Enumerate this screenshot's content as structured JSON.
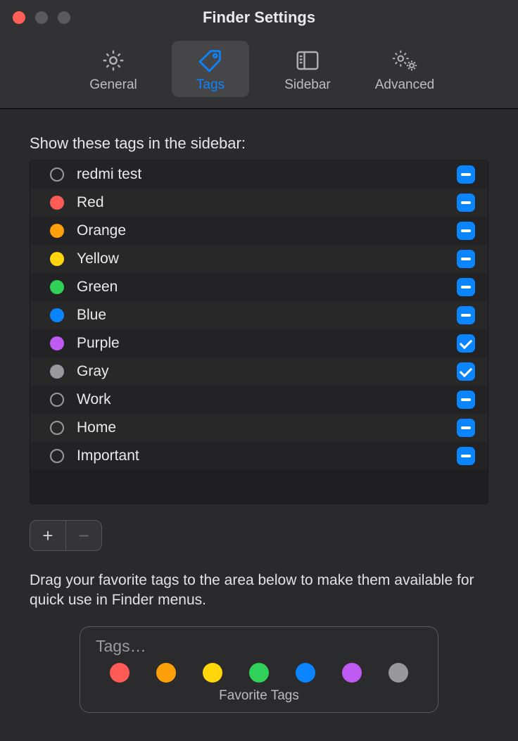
{
  "window": {
    "title": "Finder Settings"
  },
  "toolbar": {
    "items": [
      {
        "id": "general",
        "label": "General"
      },
      {
        "id": "tags",
        "label": "Tags"
      },
      {
        "id": "sidebar",
        "label": "Sidebar"
      },
      {
        "id": "advanced",
        "label": "Advanced"
      }
    ],
    "selected": "tags"
  },
  "section_label": "Show these tags in the sidebar:",
  "tags": [
    {
      "name": "redmi test",
      "color": null,
      "state": "mixed"
    },
    {
      "name": "Red",
      "color": "#ff5b56",
      "state": "mixed"
    },
    {
      "name": "Orange",
      "color": "#ff9f0a",
      "state": "mixed"
    },
    {
      "name": "Yellow",
      "color": "#ffd60a",
      "state": "mixed"
    },
    {
      "name": "Green",
      "color": "#30d158",
      "state": "mixed"
    },
    {
      "name": "Blue",
      "color": "#0a84ff",
      "state": "mixed"
    },
    {
      "name": "Purple",
      "color": "#bf5af2",
      "state": "checked"
    },
    {
      "name": "Gray",
      "color": "#98989d",
      "state": "checked"
    },
    {
      "name": "Work",
      "color": null,
      "state": "mixed"
    },
    {
      "name": "Home",
      "color": null,
      "state": "mixed"
    },
    {
      "name": "Important",
      "color": null,
      "state": "mixed"
    }
  ],
  "buttons": {
    "add": "+",
    "remove": "−"
  },
  "hint": "Drag your favorite tags to the area below to make them available for quick use in Finder menus.",
  "favorites": {
    "title": "Tags…",
    "caption": "Favorite Tags",
    "colors": [
      "#ff5b56",
      "#ff9f0a",
      "#ffd60a",
      "#30d158",
      "#0a84ff",
      "#bf5af2",
      "#98989d"
    ]
  }
}
